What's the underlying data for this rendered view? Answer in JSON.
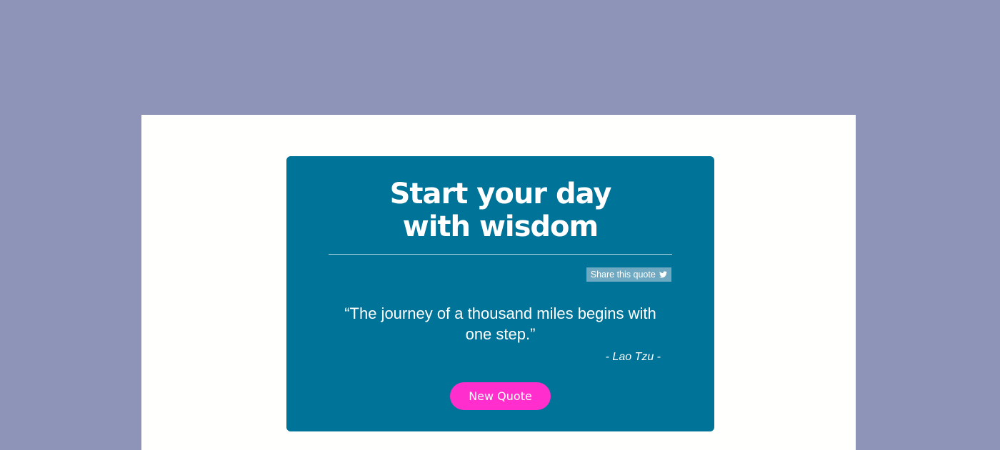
{
  "card": {
    "headline_line1": "Start your day",
    "headline_line2": "with wisdom"
  },
  "share": {
    "label": "Share this quote",
    "icon": "twitter-icon"
  },
  "quote": {
    "text": "“The journey of a thousand miles begins with one step.”",
    "author": "- Lao Tzu -"
  },
  "actions": {
    "new_quote_label": "New Quote"
  },
  "colors": {
    "background": "#8d94b8",
    "panel": "#fffffd",
    "card": "#007399",
    "share_button": "#6ea8c1",
    "accent_button": "#ff2ecc",
    "text": "#ffffff"
  }
}
